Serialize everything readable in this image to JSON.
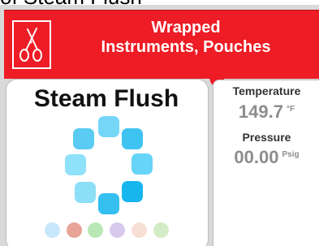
{
  "page": {
    "top_partial_title": "of Steam Flush"
  },
  "header": {
    "title_line_1": "Wrapped",
    "title_line_2": "Instruments, Pouches",
    "background_color": "#ee1c25",
    "icon": "scissors-icon"
  },
  "cycle_panel": {
    "title": "Steam Flush",
    "spinner_icon": "loading-spinner-icon",
    "spinner_colors": [
      "#75d6f7",
      "#3fc4f2",
      "#67d3f6",
      "#17b6ef",
      "#34bff0",
      "#8ddff8",
      "#90e1fa",
      "#5acbf2"
    ],
    "status_dot_colors": [
      "#c7e7fb",
      "#e8a497",
      "#b9e7b5",
      "#d7c9ec",
      "#f8dfd5",
      "#d4ecc5"
    ]
  },
  "readings": {
    "temperature": {
      "label": "Temperature",
      "value": "149.7",
      "unit": "°F"
    },
    "pressure": {
      "label": "Pressure",
      "value": "00.00",
      "unit": "Psig"
    }
  }
}
